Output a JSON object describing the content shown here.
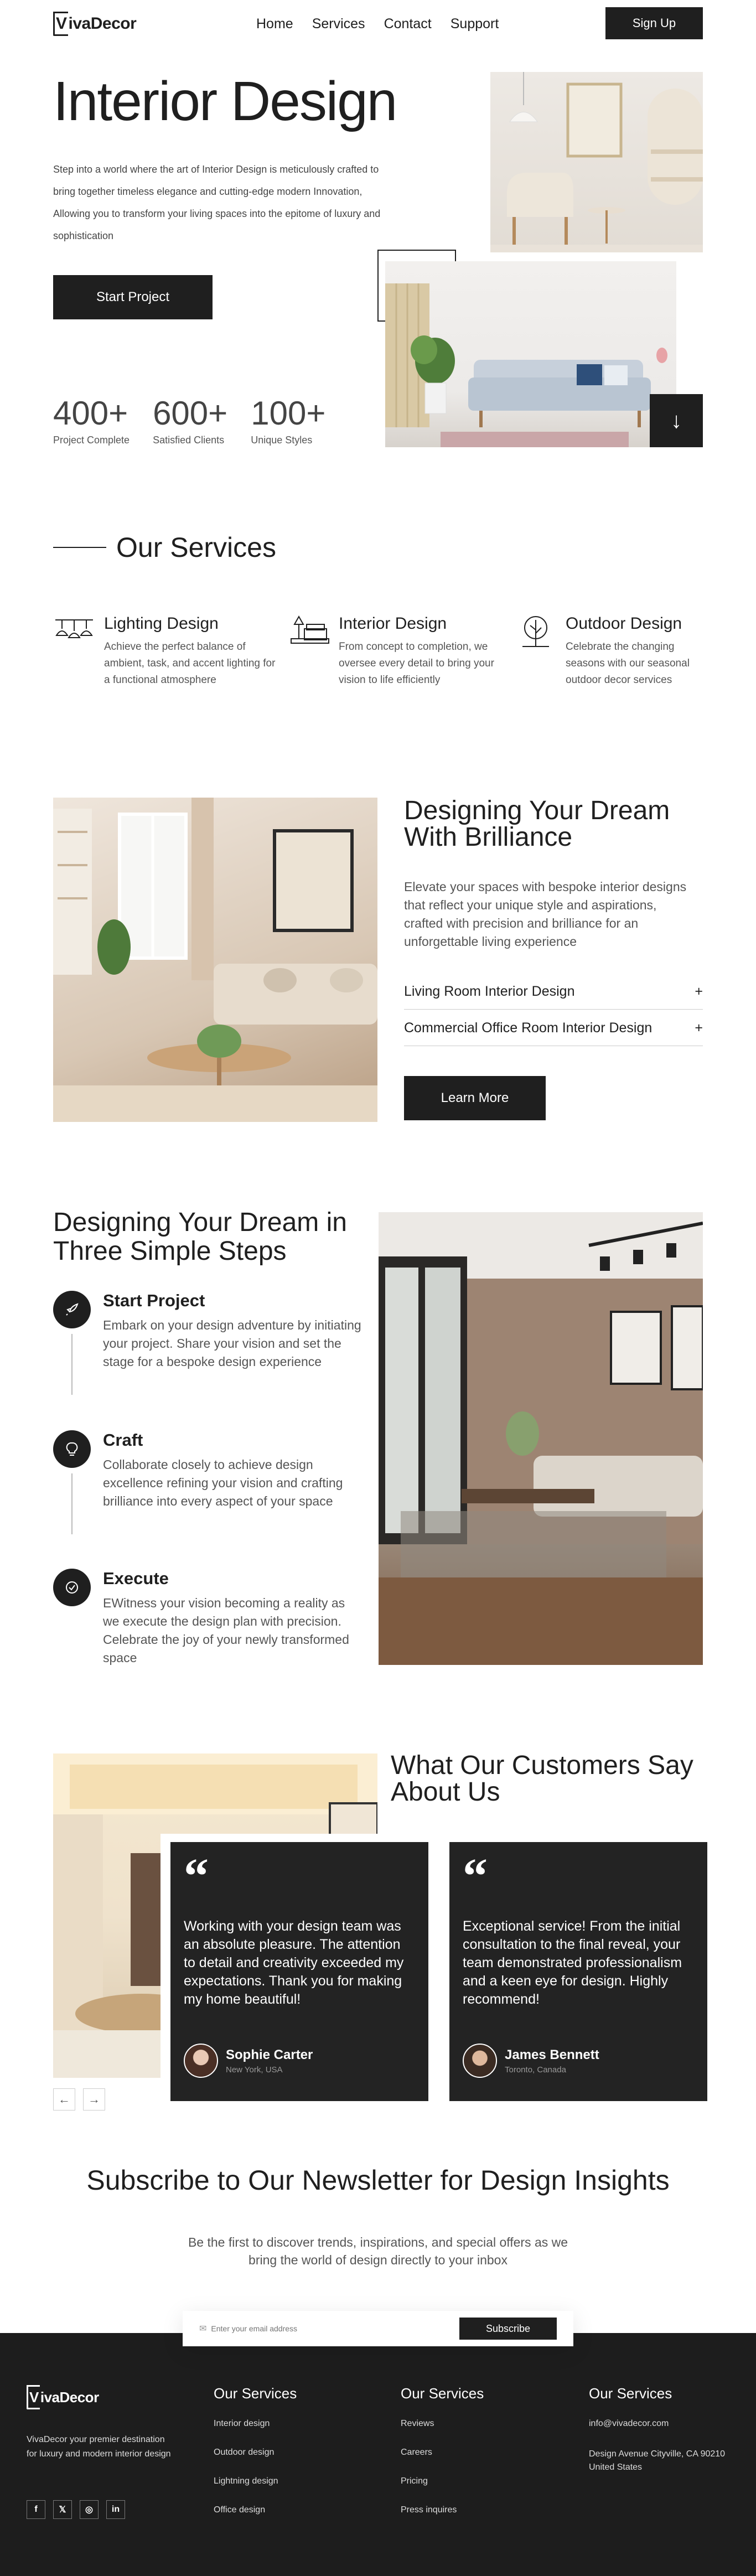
{
  "nav": {
    "logo_mark": "V",
    "logo_rest": "ivaDecor",
    "links": [
      "Home",
      "Services",
      "Contact",
      "Support"
    ],
    "signup": "Sign Up"
  },
  "hero": {
    "title": "Interior Design",
    "text": "Step into a world where the art of Interior Design is meticulously crafted to bring together timeless elegance and cutting-edge modern Innovation, Allowing you to transform your living spaces into the epitome of luxury and sophistication",
    "cta": "Start Project",
    "arrow": "↓",
    "stats": [
      {
        "n": "400+",
        "l": "Project Complete"
      },
      {
        "n": "600+",
        "l": "Satisfied Clients"
      },
      {
        "n": "100+",
        "l": "Unique Styles"
      }
    ]
  },
  "services": {
    "title": "Our Services",
    "items": [
      {
        "title": "Lighting Design",
        "text": "Achieve the perfect balance of ambient, task, and accent lighting for a functional atmosphere",
        "icon": "lamp-icon"
      },
      {
        "title": "Interior Design",
        "text": "From concept to completion, we oversee every detail to bring your vision to life efficiently",
        "icon": "furniture-icon"
      },
      {
        "title": "Outdoor Design",
        "text": "Celebrate the changing seasons with our seasonal outdoor decor services",
        "icon": "tree-icon"
      }
    ]
  },
  "brilliance": {
    "title": "Designing Your Dream With Brilliance",
    "text": "Elevate your spaces with bespoke interior designs that reflect your unique style and aspirations, crafted with precision and brilliance for an unforgettable living experience",
    "accordion": [
      "Living Room Interior Design",
      "Commercial Office Room Interior Design"
    ],
    "cta": "Learn More"
  },
  "steps": {
    "title": "Designing Your Dream in Three Simple Steps",
    "items": [
      {
        "title": "Start Project",
        "text": "Embark on your design adventure by initiating your project. Share your vision and set the stage for a bespoke design experience",
        "icon": "rocket-icon"
      },
      {
        "title": "Craft",
        "text": "Collaborate closely to achieve design excellence refining your vision and crafting brilliance into every aspect of your space",
        "icon": "lightbulb-icon"
      },
      {
        "title": "Execute",
        "text": "EWitness your vision becoming a reality as we execute the design plan with precision. Celebrate the joy of your newly transformed space",
        "icon": "check-icon"
      }
    ]
  },
  "testimonials": {
    "title": "What Our Customers Say About Us",
    "cards": [
      {
        "quote": "Working with your design team was an absolute pleasure. The attention to detail and creativity exceeded my expectations. Thank you for making my home beautiful!",
        "name": "Sophie Carter",
        "loc": "New York, USA"
      },
      {
        "quote": "Exceptional service! From the initial consultation to the final reveal, your team demonstrated professionalism and a keen eye for design. Highly recommend!",
        "name": "James Bennett",
        "loc": "Toronto, Canada"
      }
    ],
    "prev": "←",
    "next": "→"
  },
  "newsletter": {
    "title": "Subscribe to Our Newsletter for Design Insights",
    "text": "Be the first to discover trends, inspirations, and special offers as we bring the world of design directly to your inbox",
    "placeholder": "Enter your email address",
    "button": "Subscribe"
  },
  "footer": {
    "logo_mark": "V",
    "logo_rest": "ivaDecor",
    "about": "VivaDecor your premier destination for luxury and modern interior design",
    "cols": [
      {
        "title": "Our Services",
        "items": [
          "Interior design",
          "Outdoor design",
          "Lightning design",
          "Office design"
        ]
      },
      {
        "title": "Our Services",
        "items": [
          "Reviews",
          "Careers",
          "Pricing",
          "Press inquires"
        ]
      },
      {
        "title": "Our Services",
        "items": [
          "info@vivadecor.com",
          "Design Avenue Cityville, CA 90210 United States"
        ]
      }
    ],
    "social": [
      "f",
      "𝕏",
      "◎",
      "in"
    ]
  }
}
